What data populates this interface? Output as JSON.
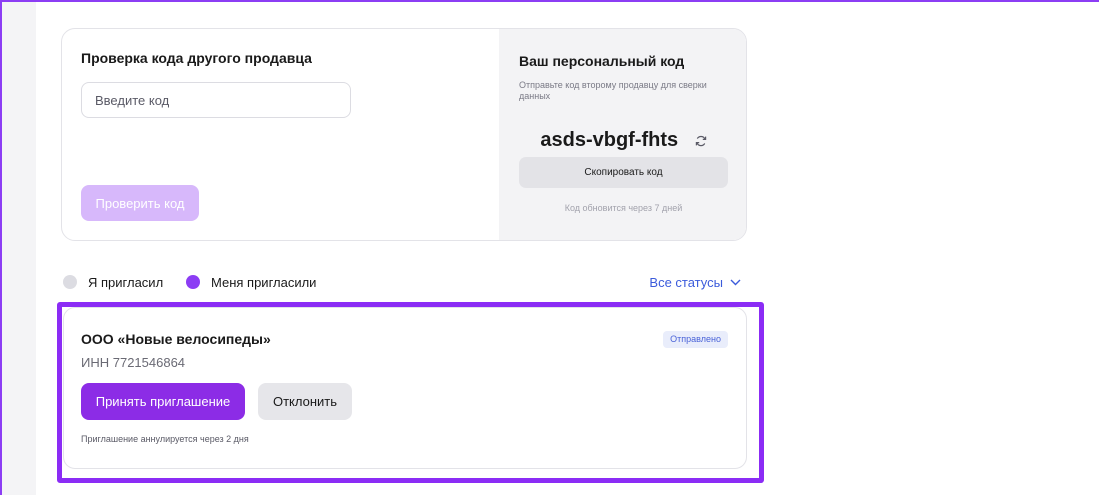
{
  "check_section": {
    "title": "Проверка кода другого продавца",
    "input_placeholder": "Введите код",
    "input_value": "",
    "check_button": "Проверить код"
  },
  "personal_code": {
    "title": "Ваш персональный код",
    "hint": "Отправьте код второму продавцу для сверки данных",
    "code": "asds-vbgf-fhts",
    "refresh_icon": "refresh-icon",
    "copy_button": "Скопировать код",
    "update_note": "Код обновится через 7 дней"
  },
  "filters": {
    "options": [
      {
        "label": "Я пригласил",
        "selected": false
      },
      {
        "label": "Меня пригласили",
        "selected": true
      }
    ],
    "status_select": "Все статусы",
    "status_icon": "chevron-down-icon"
  },
  "invitation": {
    "company": "ООО «Новые велосипеды»",
    "inn": "ИНН 7721546864",
    "status": "Отправлено",
    "accept_button": "Принять приглашение",
    "decline_button": "Отклонить",
    "expire_note": "Приглашение аннулируется через 2 дня"
  },
  "colors": {
    "accent": "#8c2ce6",
    "accent_disabled": "#d7b8fb",
    "highlight": "#8b2cf5",
    "link": "#3b5bdb",
    "badge_bg": "#e9edfb",
    "radio_off": "#dcdce2"
  }
}
